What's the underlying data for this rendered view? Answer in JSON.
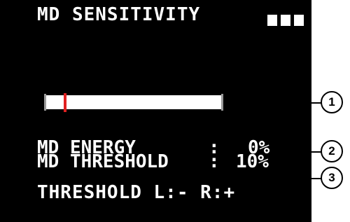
{
  "screen": {
    "title": "MD SENSITIVITY",
    "battery_segments": 3,
    "meter": {
      "threshold_percent": 10,
      "marker_color": "#e02020"
    },
    "energy": {
      "label": "MD ENERGY",
      "separator": ":",
      "value": "0%"
    },
    "threshold": {
      "label": "MD THRESHOLD",
      "separator": ":",
      "value": "10%"
    },
    "footer": "THRESHOLD L:- R:+"
  },
  "callouts": [
    {
      "number": "1"
    },
    {
      "number": "2"
    },
    {
      "number": "3"
    }
  ]
}
